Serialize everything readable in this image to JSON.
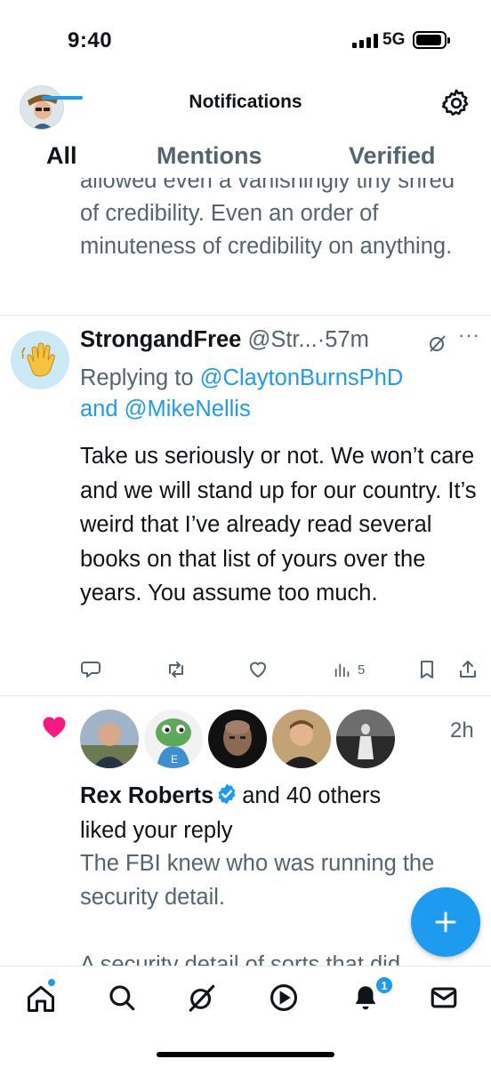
{
  "status_bar": {
    "time": "9:40",
    "network": "5G"
  },
  "header": {
    "title": "Notifications"
  },
  "tabs": [
    {
      "label": "All",
      "active": true
    },
    {
      "label": "Mentions",
      "active": false
    },
    {
      "label": "Verified",
      "active": false
    }
  ],
  "previous_item": {
    "text": "allowed even a vanishingly tiny shred of credibility. Even an order of minuteness of credibility on anything."
  },
  "tweet": {
    "name": "StrongandFree",
    "handle": "@Str...",
    "time": "57m",
    "replying_prefix": "Replying to",
    "replying_user1": "@ClaytonBurnsPhD",
    "replying_and": "and",
    "replying_user2": "@MikeNellis",
    "body": "Take us seriously or not. We won’t care and we will stand up for our country. It’s weird that I’ve already read several books on that list of yours over the years. You assume too much.",
    "views": "5"
  },
  "like_notification": {
    "time": "2h",
    "name": "Rex Roberts",
    "suffix": "and 40 others",
    "action": "liked your reply",
    "text": "The FBI knew who was running the security detail.\n\nA security detail of sorts that did"
  },
  "bottom_nav": {
    "notifications_badge": "1"
  },
  "colors": {
    "accent": "#1d9bf0",
    "like": "#f91880",
    "secondary_text": "#536471"
  }
}
